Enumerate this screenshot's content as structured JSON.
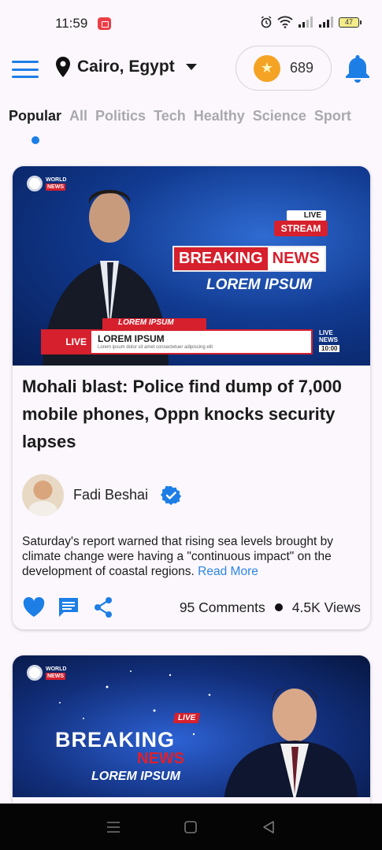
{
  "status_bar": {
    "time": "11:59",
    "battery": "47"
  },
  "header": {
    "location": "Cairo, Egypt",
    "coins": "689"
  },
  "categories": [
    {
      "label": "Popular",
      "active": true
    },
    {
      "label": "All"
    },
    {
      "label": "Politics"
    },
    {
      "label": "Tech"
    },
    {
      "label": "Healthy"
    },
    {
      "label": "Science"
    },
    {
      "label": "Sport"
    }
  ],
  "colors": {
    "accent": "#1d7ee6",
    "link": "#2c86e4",
    "news_red": "#d6202d"
  },
  "posts": [
    {
      "image": {
        "logo_world": "WORLD",
        "logo_news": "NEWS",
        "live": "LIVE",
        "stream": "STREAM",
        "breaking": "BREAKING",
        "news": "NEWS",
        "lorem": "LOREM IPSUM",
        "lower_third_tag": "LOREM IPSUM",
        "lower_third_live": "LIVE",
        "lower_third_title": "LOREM IPSUM",
        "lower_third_sub": "Lorem ipsum dolor sit amet consectetuer adipiscing elit",
        "live_news_1": "LIVE",
        "live_news_2": "NEWS",
        "live_news_time": "10:00"
      },
      "title": "Mohali blast: Police find dump of 7,000 mobile phones, Oppn knocks security lapses",
      "author": "Fadi Beshai",
      "description": "Saturday's report warned that rising sea levels brought by climate change were having a \"continuous impact\" on the development of coastal regions.",
      "read_more": "Read More",
      "comments": "95 Comments",
      "views": "4.5K Views"
    },
    {
      "image": {
        "logo_world": "WORLD",
        "logo_news": "NEWS",
        "live": "LIVE",
        "breaking": "BREAKING",
        "news": "NEWS",
        "lorem": "LOREM IPSUM"
      }
    }
  ]
}
